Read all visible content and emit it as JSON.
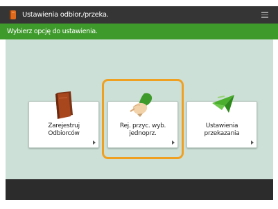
{
  "window": {
    "title": "Ustawienia odbior./przeka.",
    "icon": "document-icon",
    "menu_icon": "menu-icon"
  },
  "instruction": "Wybierz opcję do ustawienia.",
  "tiles": [
    {
      "label": "Zarejestruj\nOdbiorców",
      "icon": "address-book-icon",
      "selected": false
    },
    {
      "label": "Rej. przyc. wyb.\njednoprz.",
      "icon": "hand-pointer-icon",
      "selected": true
    },
    {
      "label": "Ustawienia\nprzekazania",
      "icon": "paper-plane-icon",
      "selected": false
    }
  ],
  "colors": {
    "titlebar": "#353535",
    "instruction_bar": "#3f9a2c",
    "content_background": "#cde0d8",
    "selection_ring": "#f0a020",
    "footer": "#2c2c2c"
  }
}
